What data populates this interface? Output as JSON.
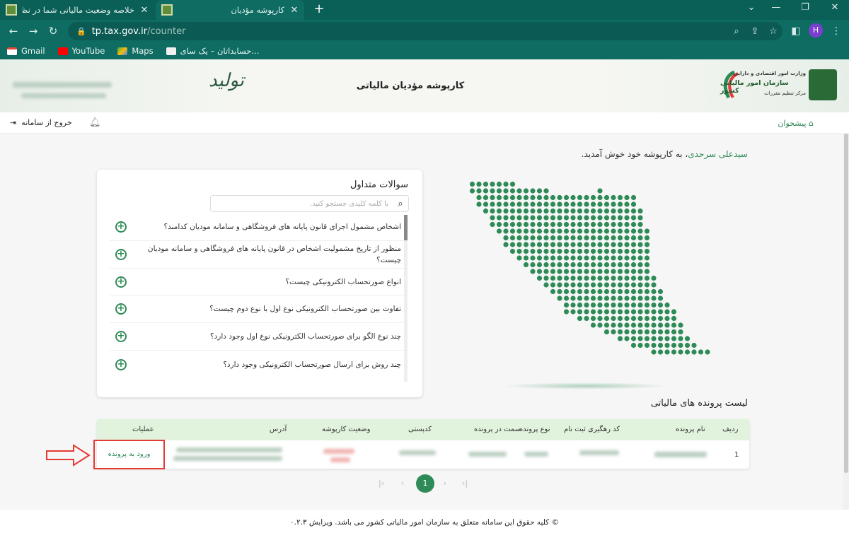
{
  "tabs": [
    {
      "title": "خلاصه وضعیت مالیاتی شما در نظام",
      "active": false
    },
    {
      "title": "کارپوشه مؤدیان",
      "active": true
    }
  ],
  "toolbar": {
    "url_host": "tp.tax.gov.ir",
    "url_path": "/counter",
    "avatar": "H"
  },
  "bookmarks": [
    "Gmail",
    "YouTube",
    "Maps",
    "حسابداتان – یک سای..."
  ],
  "header": {
    "title": "کارپوشه مؤدیان مالیاتی",
    "logo_line1": "وزارت امور اقتصادی و دارایی",
    "logo_line2": "سازمان امور مالیاتی کشور",
    "logo_line3": "مرکز تنظیم مقررات",
    "signature": "تولید"
  },
  "subbar": {
    "home": "پیشخوان",
    "logout": "خروج از سامانه"
  },
  "welcome": {
    "name": "سیدعلی سرحدی",
    "suffix": "، به کارپوشه خود خوش آمدید."
  },
  "faq": {
    "title": "سوالات متداول",
    "search_placeholder": "با کلمه کلیدی جستجو کنید.",
    "items": [
      "اشخاص مشمول اجرای قانون پایانه های فروشگاهی و سامانه مودیان کدامند؟",
      "منظور از تاریخ مشمولیت اشخاص در قانون پایانه های فروشگاهی و سامانه مودیان چیست؟",
      "انواع صورتحساب الکترونیکی چیست؟",
      "تفاوت بین صورتحساب الکترونیکی نوع اول با نوع دوم چیست؟",
      "چند نوع الگو برای صورتحساب الکترونیکی نوع اول وجود دارد؟",
      "چند روش برای ارسال صورتحساب الکترونیکی وجود دارد؟"
    ]
  },
  "files": {
    "title": "لیست پرونده های مالیاتی",
    "headers": [
      "ردیف",
      "نام پرونده",
      "کد رهگیری ثبت نام",
      "نوع پرونده",
      "سمت در پرونده",
      "کدپستی",
      "وضعیت کارپوشه",
      "آدرس",
      "عملیات"
    ],
    "row": {
      "index": "1",
      "action": "ورود به پرونده"
    },
    "page": "1"
  },
  "footer": "© کلیه حقوق این سامانه متعلق به سازمان امور مالیاتی کشور می باشد. ویرایش ۰.۲.۳",
  "colors": {
    "primary": "#2e8b57",
    "browser": "#0e6c63",
    "highlight": "#e53935"
  }
}
